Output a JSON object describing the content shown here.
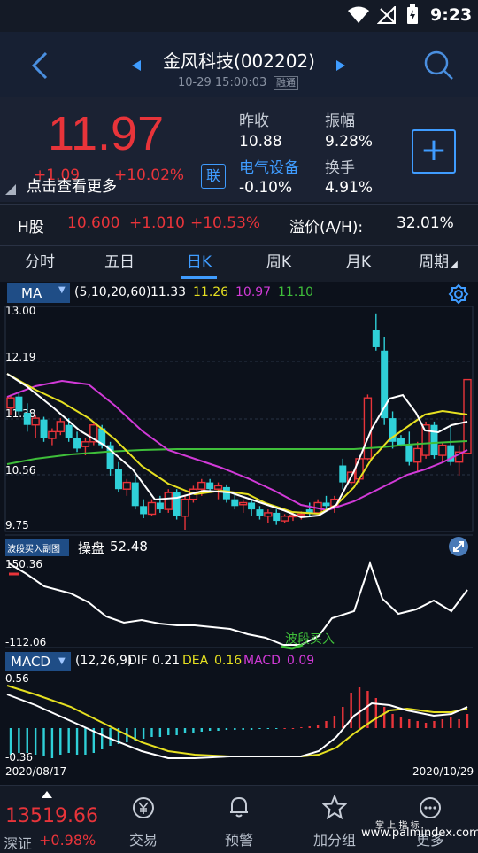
{
  "status": {
    "time": "9:23"
  },
  "header": {
    "title": "金风科技(002202)",
    "subtitle": "10-29 15:00:03",
    "badge": "融通"
  },
  "quote": {
    "price": "11.97",
    "change": "+1.09",
    "change_pct": "+10.02%",
    "more_label": "点击查看更多",
    "link_badge": "联",
    "fields": [
      {
        "label": "昨收",
        "value": "10.88"
      },
      {
        "label": "振幅",
        "value": "9.28%"
      },
      {
        "label": "电气设备",
        "value": "-0.10%"
      },
      {
        "label": "换手",
        "value": "4.91%"
      }
    ],
    "add_label": "+"
  },
  "hshare": {
    "label": "H股",
    "price": "10.600",
    "change": "+1.010",
    "pct": "+10.53%",
    "premium_label": "溢价(A/H):",
    "premium": "32.01%"
  },
  "tabs": [
    "分时",
    "五日",
    "日K",
    "周K",
    "月K",
    "周期"
  ],
  "active_tab": 2,
  "ma": {
    "selector": "MA",
    "params": "(5,10,20,60)",
    "v5": "11.33",
    "v10": "11.26",
    "v20": "10.97",
    "v60": "11.10"
  },
  "price_axis": [
    "13.00",
    "12.19",
    "11.38",
    "10.56",
    "9.75"
  ],
  "sub1": {
    "selector": "波段买入副图",
    "label": "操盘",
    "value": "52.48",
    "ymax": "150.36",
    "ymin": "-112.06",
    "signal": "波段买入"
  },
  "macd": {
    "selector": "MACD",
    "params": "(12,26,9)",
    "dif_label": "DIF",
    "dif": "0.21",
    "dea_label": "DEA",
    "dea": "0.16",
    "macd_label": "MACD",
    "macd_value": "0.09",
    "ymax": "0.56",
    "ymin": "-0.36"
  },
  "dates": {
    "start": "2020/08/17",
    "end": "2020/10/29"
  },
  "index": {
    "value": "13519.66",
    "name": "深证",
    "pct": "+0.98%"
  },
  "nav": [
    "交易",
    "预警",
    "加分组",
    "更多"
  ],
  "watermark": {
    "line1": "掌 上 指 标",
    "line2": "www.palmindex.com"
  },
  "colors": {
    "up": "#e8343a",
    "down": "#2fd0d8",
    "ma5": "#ffffff",
    "ma10": "#e6e021",
    "ma20": "#d23ad8",
    "ma60": "#3fbf3a",
    "accent": "#3f9cff"
  },
  "chart_data": {
    "type": "candlestick",
    "x_range": [
      "2020/08/17",
      "2020/10/29"
    ],
    "ylim": [
      9.75,
      13.0
    ],
    "candles": [
      [
        11.55,
        11.75,
        11.45,
        11.7
      ],
      [
        11.72,
        11.78,
        11.45,
        11.5
      ],
      [
        11.48,
        11.62,
        11.2,
        11.3
      ],
      [
        11.3,
        11.45,
        11.1,
        11.4
      ],
      [
        11.38,
        11.42,
        11.05,
        11.1
      ],
      [
        11.1,
        11.25,
        11.0,
        11.2
      ],
      [
        11.2,
        11.4,
        11.15,
        11.35
      ],
      [
        11.3,
        11.4,
        11.05,
        11.1
      ],
      [
        11.1,
        11.2,
        10.9,
        10.95
      ],
      [
        10.98,
        11.1,
        10.85,
        11.05
      ],
      [
        11.05,
        11.35,
        11.0,
        11.3
      ],
      [
        11.25,
        11.3,
        10.95,
        11.0
      ],
      [
        11.0,
        11.05,
        10.55,
        10.65
      ],
      [
        10.65,
        10.75,
        10.3,
        10.35
      ],
      [
        10.35,
        10.5,
        10.25,
        10.45
      ],
      [
        10.45,
        10.55,
        10.05,
        10.1
      ],
      [
        10.1,
        10.2,
        9.92,
        9.98
      ],
      [
        9.98,
        10.2,
        9.95,
        10.15
      ],
      [
        10.15,
        10.25,
        10.0,
        10.05
      ],
      [
        10.05,
        10.35,
        10.0,
        10.3
      ],
      [
        10.3,
        10.35,
        9.9,
        9.95
      ],
      [
        9.95,
        10.25,
        9.75,
        10.2
      ],
      [
        10.2,
        10.4,
        10.15,
        10.35
      ],
      [
        10.35,
        10.5,
        10.25,
        10.45
      ],
      [
        10.45,
        10.5,
        10.3,
        10.35
      ],
      [
        10.35,
        10.45,
        10.2,
        10.4
      ],
      [
        10.38,
        10.42,
        10.15,
        10.2
      ],
      [
        10.2,
        10.3,
        10.05,
        10.1
      ],
      [
        10.12,
        10.2,
        10.0,
        10.15
      ],
      [
        10.15,
        10.2,
        9.95,
        10.05
      ],
      [
        10.05,
        10.1,
        9.9,
        9.95
      ],
      [
        9.95,
        10.05,
        9.85,
        10.0
      ],
      [
        10.0,
        10.05,
        9.82,
        9.88
      ],
      [
        9.88,
        9.98,
        9.85,
        9.95
      ],
      [
        9.95,
        10.0,
        9.88,
        9.96
      ],
      [
        9.96,
        10.02,
        9.9,
        9.98
      ],
      [
        10.05,
        10.15,
        9.95,
        10.0
      ],
      [
        10.0,
        10.2,
        9.98,
        10.15
      ],
      [
        10.15,
        10.25,
        10.05,
        10.1
      ],
      [
        10.1,
        10.25,
        10.0,
        10.2
      ],
      [
        10.7,
        10.8,
        10.35,
        10.45
      ],
      [
        10.45,
        10.62,
        10.4,
        10.6
      ],
      [
        10.5,
        10.85,
        10.45,
        10.8
      ],
      [
        10.8,
        11.75,
        10.78,
        11.7
      ],
      [
        12.7,
        12.95,
        12.4,
        12.45
      ],
      [
        12.4,
        12.6,
        11.3,
        11.4
      ],
      [
        11.4,
        11.5,
        10.95,
        11.05
      ],
      [
        11.1,
        11.15,
        10.98,
        11.0
      ],
      [
        11.0,
        11.2,
        10.7,
        10.75
      ],
      [
        10.75,
        11.05,
        10.6,
        10.95
      ],
      [
        10.85,
        11.35,
        10.8,
        11.3
      ],
      [
        11.3,
        11.35,
        10.8,
        10.85
      ],
      [
        10.85,
        11.05,
        10.75,
        11.0
      ],
      [
        11.0,
        11.3,
        10.7,
        10.75
      ],
      [
        10.75,
        11.0,
        10.55,
        10.9
      ],
      [
        10.88,
        11.97,
        10.88,
        11.97
      ]
    ]
  }
}
